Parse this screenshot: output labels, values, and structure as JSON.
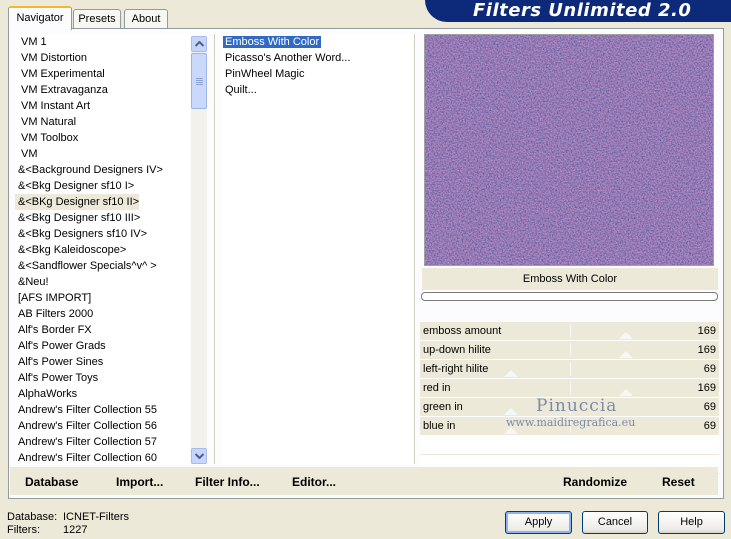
{
  "header": {
    "title": "Filters Unlimited 2.0"
  },
  "tabs": [
    {
      "label": "Navigator",
      "active": true
    },
    {
      "label": "Presets",
      "active": false
    },
    {
      "label": "About",
      "active": false
    }
  ],
  "categories": {
    "items": [
      {
        "label": "VM 1"
      },
      {
        "label": "VM Distortion"
      },
      {
        "label": "VM Experimental"
      },
      {
        "label": "VM Extravaganza"
      },
      {
        "label": "VM Instant Art"
      },
      {
        "label": "VM Natural"
      },
      {
        "label": "VM Toolbox"
      },
      {
        "label": "VM"
      },
      {
        "label": "&<Background Designers IV>"
      },
      {
        "label": "&<Bkg Designer sf10 I>"
      },
      {
        "label": "&<BKg Designer sf10 II>",
        "selected": true
      },
      {
        "label": "&<Bkg Designer sf10 III>"
      },
      {
        "label": "&<Bkg Designers sf10 IV>"
      },
      {
        "label": "&<Bkg Kaleidoscope>"
      },
      {
        "label": "&<Sandflower Specials^v^ >"
      },
      {
        "label": "&Neu!"
      },
      {
        "label": "[AFS IMPORT]"
      },
      {
        "label": "AB Filters 2000"
      },
      {
        "label": "Alf's Border FX"
      },
      {
        "label": "Alf's Power Grads"
      },
      {
        "label": "Alf's Power Sines"
      },
      {
        "label": "Alf's Power Toys"
      },
      {
        "label": "AlphaWorks"
      },
      {
        "label": "Andrew's Filter Collection 55"
      },
      {
        "label": "Andrew's Filter Collection 56"
      },
      {
        "label": "Andrew's Filter Collection 57"
      },
      {
        "label": "Andrew's Filter Collection 60"
      }
    ]
  },
  "filters": {
    "items": [
      {
        "label": "Emboss With Color",
        "selected": true
      },
      {
        "label": "Picasso's Another Word..."
      },
      {
        "label": "PinWheel Magic"
      },
      {
        "label": "Quilt..."
      }
    ]
  },
  "preview": {
    "label": "Emboss With Color"
  },
  "params": [
    {
      "label": "emboss amount",
      "value": "169",
      "level": 0.663
    },
    {
      "label": "up-down hilite",
      "value": "169",
      "level": 0.663
    },
    {
      "label": "left-right hilite",
      "value": "69",
      "level": 0.27
    },
    {
      "label": "red in",
      "value": "169",
      "level": 0.663
    },
    {
      "label": "green in",
      "value": "69",
      "level": 0.27
    },
    {
      "label": "blue in",
      "value": "69",
      "level": 0.27
    }
  ],
  "watermark": {
    "line1": "Pinuccia",
    "line2": "www.maidiregrafica.eu"
  },
  "actions": {
    "database": "Database",
    "import": "Import...",
    "filter_info": "Filter Info...",
    "editor": "Editor...",
    "randomize": "Randomize",
    "reset": "Reset"
  },
  "footer": {
    "database_label": "Database:",
    "database_value": "ICNET-Filters",
    "filters_label": "Filters:",
    "filters_value": "1227",
    "apply": "Apply",
    "cancel": "Cancel",
    "help": "Help"
  },
  "colors": {
    "banner": "#0d2a7a",
    "selection": "#316ac5",
    "preview_base": "#b07fbf",
    "preview_dark": "#3b4f8c",
    "preview_pink": "#e6a6de"
  }
}
